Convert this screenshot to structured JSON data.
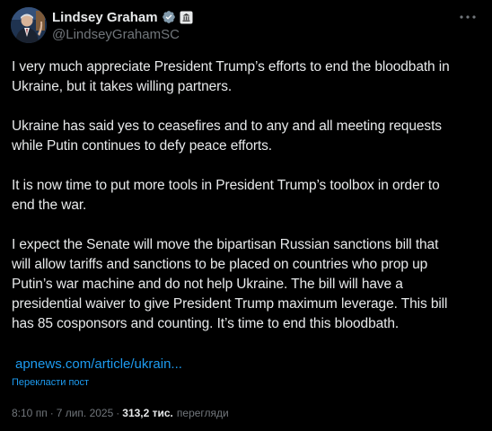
{
  "author": {
    "display_name": "Lindsey Graham",
    "handle": "@LindseyGrahamSC"
  },
  "icons": {
    "verified": "verified-badge-icon",
    "affiliation": "government-affiliation-icon",
    "more": "more-options-icon"
  },
  "colors": {
    "background": "#000000",
    "text": "#e7e9ea",
    "secondary": "#71767b",
    "link": "#1d9bf0"
  },
  "post": {
    "paragraphs": [
      [
        "I very much appreciate President Trump’s efforts to end the bloodbath in",
        "Ukraine, but it takes willing partners."
      ],
      [
        "Ukraine has said yes to ceasefires and to any and all meeting requests",
        "while Putin continues to defy peace efforts."
      ],
      [
        "It is now time to put more tools in President Trump’s toolbox in order to",
        "end the war."
      ],
      [
        "I expect the Senate will move the bipartisan Russian sanctions bill that",
        "will allow tariffs and sanctions to be placed on countries who prop up",
        "Putin’s war machine and do not help Ukraine. The bill will have a",
        "presidential waiver to give President Trump maximum leverage. This bill",
        "has 85 cosponsors and counting. It’s time to end this bloodbath."
      ]
    ],
    "link": "apnews.com/article/ukrain...",
    "translate": "Перекласти пост"
  },
  "meta": {
    "time": "8:10 пп",
    "separator": "·",
    "date": "7 лип. 2025",
    "views_count": "313,2 тис.",
    "views_label": "перегляди"
  }
}
